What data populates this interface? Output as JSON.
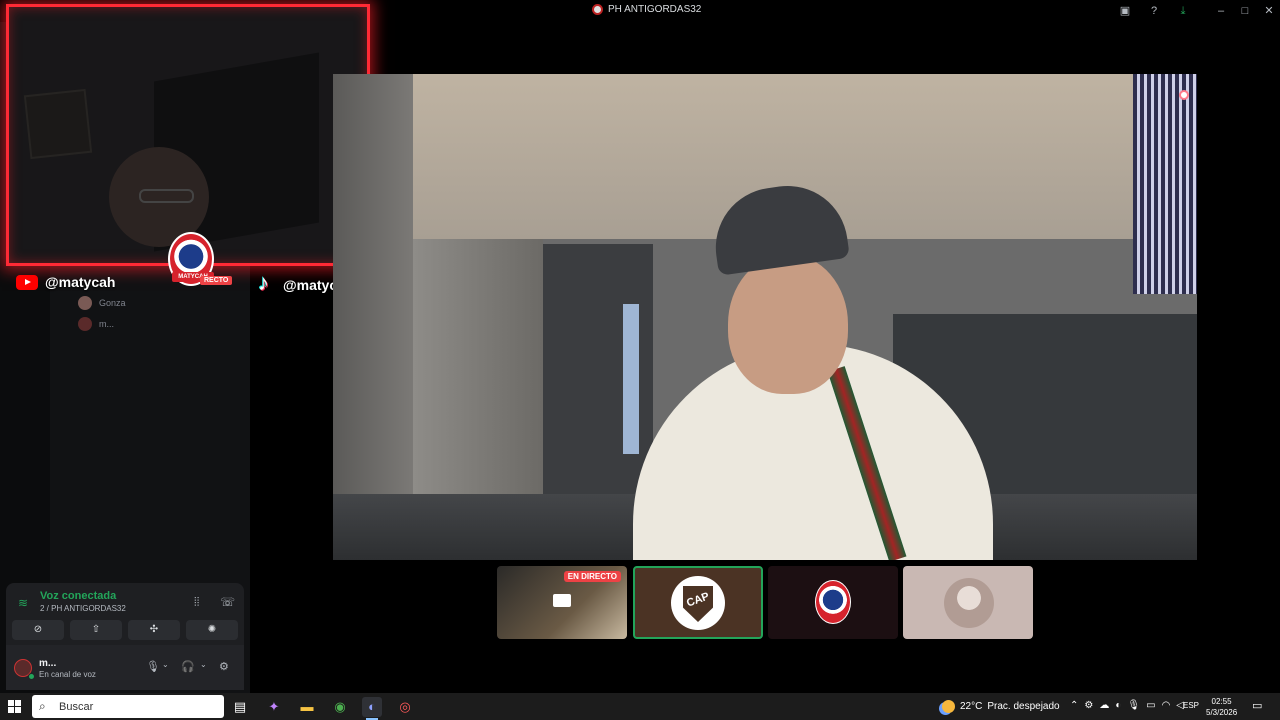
{
  "window": {
    "title": "PH ANTIGORDAS32",
    "controls": [
      "minimize",
      "maximize",
      "close"
    ]
  },
  "sidebar": {
    "voice_users": [
      {
        "name": "Gonza"
      },
      {
        "name": "m..."
      }
    ]
  },
  "overlay": {
    "youtube_handle": "@matycah",
    "tiktok_handle": "@matycah",
    "live_tag": "RECTO",
    "badge_text": "MATYCAH"
  },
  "voice_panel": {
    "status": "Voz conectada",
    "channel": "2 / PH ANTIGORDAS32",
    "buttons": [
      "camera-off",
      "share-screen",
      "activities",
      "soundboard"
    ]
  },
  "user_panel": {
    "name": "m...",
    "status": "En canal de voz"
  },
  "tiles": [
    {
      "type": "screen-share",
      "live_label": "EN DIRECTO"
    },
    {
      "type": "avatar",
      "logo_text": "CAP",
      "speaking": true
    },
    {
      "type": "avatar",
      "logo": "matycah-badge"
    },
    {
      "type": "avatar",
      "logo": "user-photo"
    }
  ],
  "taskbar": {
    "search_placeholder": "Buscar",
    "weather_temp": "22°C",
    "weather_desc": "Prac. despejado",
    "language": "ESP",
    "time": "02:55",
    "date": "5/3/2026"
  },
  "colors": {
    "accent_green": "#23a55a",
    "live_red": "#ed4245",
    "webcam_border": "#ff2a35"
  }
}
